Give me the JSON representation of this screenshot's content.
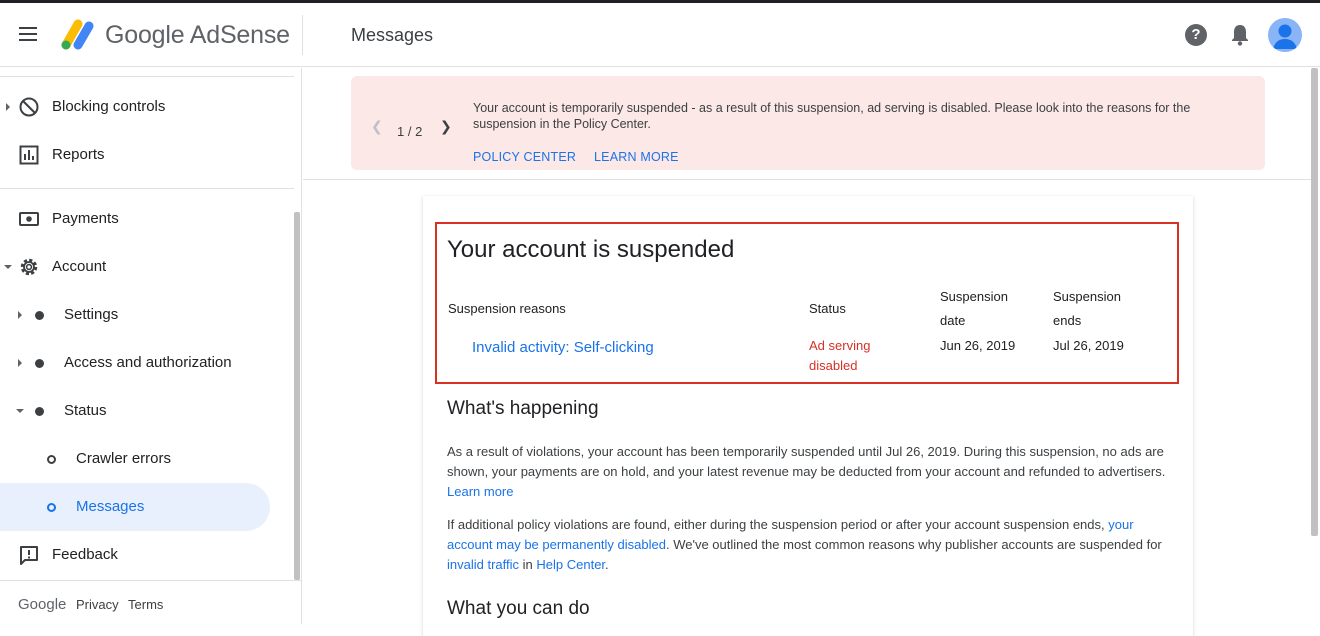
{
  "header": {
    "brand": "Google AdSense",
    "page_title": "Messages",
    "help": "?"
  },
  "sidebar": {
    "items": [
      {
        "label": "Blocking controls"
      },
      {
        "label": "Reports"
      },
      {
        "label": "Payments"
      },
      {
        "label": "Account"
      },
      {
        "label": "Settings"
      },
      {
        "label": "Access and authorization"
      },
      {
        "label": "Status"
      },
      {
        "label": "Crawler errors"
      },
      {
        "label": "Messages"
      },
      {
        "label": "Feedback"
      }
    ],
    "footer": {
      "google": "Google",
      "privacy": "Privacy",
      "terms": "Terms"
    }
  },
  "banner": {
    "pager": "1 / 2",
    "message": "Your account is temporarily suspended - as a result of this suspension, ad serving is disabled. Please look into the reasons for the suspension in the Policy Center.",
    "policy_center": "POLICY CENTER",
    "learn_more": "LEARN MORE"
  },
  "card": {
    "title": "Your account is suspended",
    "columns": {
      "reasons": "Suspension reasons",
      "status": "Status",
      "date_1": "Suspension",
      "date_2": "date",
      "ends_1": "Suspension",
      "ends_2": "ends"
    },
    "row": {
      "reason": "Invalid activity: Self-clicking",
      "status_1": "Ad serving",
      "status_2": "disabled",
      "date": "Jun 26, 2019",
      "ends": "Jul 26, 2019"
    },
    "happening_title": "What's happening",
    "para1_text": "As a result of violations, your account has been temporarily suspended until Jul 26, 2019. During this suspension, no ads are shown, your payments are on hold, and your latest revenue may be deducted from your account and refunded to advertisers.",
    "para1_link": "Learn more",
    "para2_a": "If additional policy violations are found, either during the suspension period or after your account suspension ends,",
    "para2_link1": "your account may be permanently disabled",
    "para2_b": ". We've outlined the most common reasons why publisher accounts are suspended for",
    "para2_link2": "invalid traffic",
    "para2_c": "in",
    "para2_link3": "Help Center",
    "para2_d": ".",
    "can_do_title": "What you can do"
  },
  "colors": {
    "accent": "#1a73e8",
    "error": "#d93025",
    "banner_bg": "#fce8e6"
  }
}
